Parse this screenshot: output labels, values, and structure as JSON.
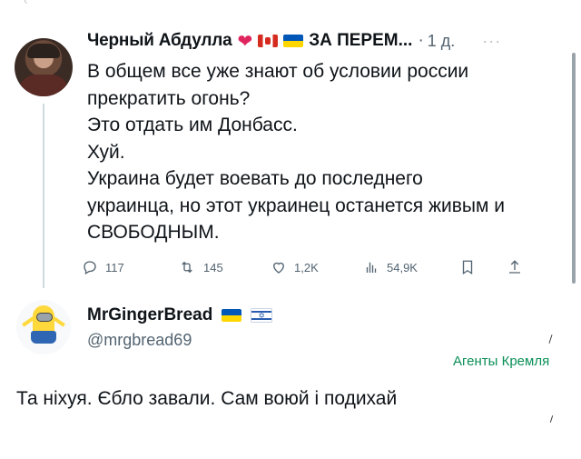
{
  "post1": {
    "author": "Черный Абдулла",
    "heart_glyph": "❤",
    "name_tail": "ЗА ПЕРЕМ...",
    "separator": "·",
    "time": "1 д.",
    "more_glyph": "···",
    "lines": [
      "В общем все уже знают об условии россии",
      "прекратить огонь?",
      "Это отдать им Донбасс.",
      "Хуй.",
      "Украина будет воевать до последнего",
      "украинца, но этот украинец останется живым и",
      "СВОБОДНЫМ."
    ],
    "stats": {
      "replies": "117",
      "reposts": "145",
      "likes": "1,2K",
      "views": "54,9K"
    }
  },
  "post2": {
    "author": "MrGingerBread",
    "handle": "@mrgbread69",
    "text": "Та ніхуя. Єбло завали. Сам воюй і подихай"
  },
  "annotation": "Агенты Кремля",
  "colors": {
    "text": "#0f1419",
    "secondary": "#536471",
    "like_red": "#e0245e",
    "annotation_green": "#0a8f57",
    "thread_line": "#cfd9de"
  },
  "icons": [
    "reply-icon",
    "repost-icon",
    "like-icon",
    "views-icon",
    "bookmark-icon",
    "share-icon",
    "heart-emoji",
    "flag-canada",
    "flag-ukraine",
    "flag-israel"
  ]
}
